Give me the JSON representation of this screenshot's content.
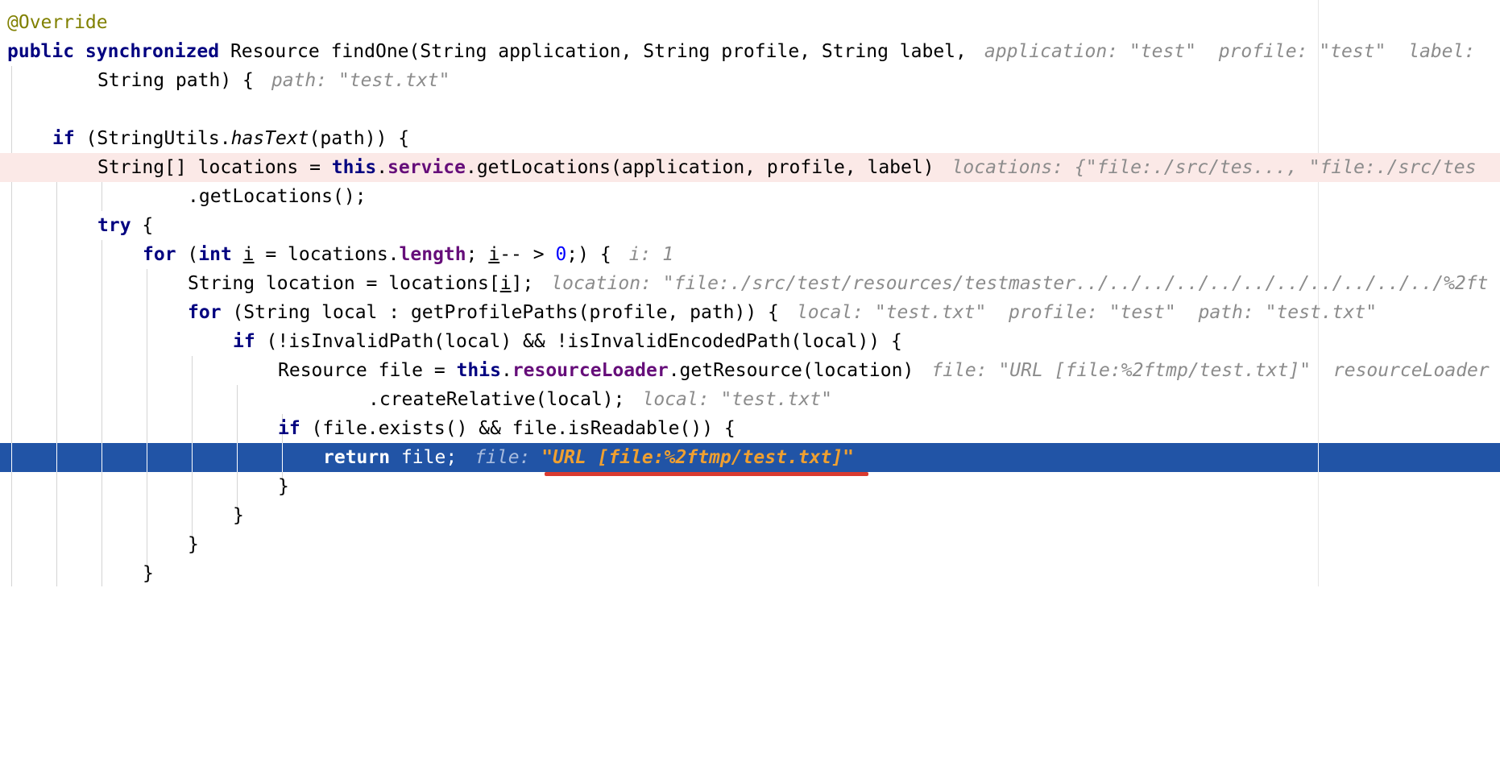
{
  "code": {
    "l1": "@Override",
    "l2_kw": "public synchronized",
    "l2_sig": " Resource findOne(String application, String profile, String label,",
    "l2_hint_k1": "application:",
    "l2_hint_v1": "\"test\"",
    "l2_hint_k2": "profile:",
    "l2_hint_v2": "\"test\"",
    "l2_hint_k3": "label:",
    "l3_code": "String path) {",
    "l3_hint_k": "path:",
    "l3_hint_v": "\"test.txt\"",
    "l5_kw": "if",
    "l5_a": " (StringUtils.",
    "l5_it": "hasText",
    "l5_b": "(path)) {",
    "l6_a": "String[] locations = ",
    "l6_this": "this",
    "l6_dot": ".",
    "l6_field": "service",
    "l6_b": ".getLocations(application, profile, label)",
    "l6_hint_k": "locations:",
    "l6_hint_v": "{\"file:./src/tes..., \"file:./src/tes",
    "l7_code": ".getLocations();",
    "l8_kw": "try",
    "l8_b": " {",
    "l9_kw": "for",
    "l9_a": " (",
    "l9_int": "int",
    "l9_sp": " ",
    "l9_i": "i",
    "l9_b": " = locations.",
    "l9_len": "length",
    "l9_c": "; ",
    "l9_i2": "i",
    "l9_d": "-- > ",
    "l9_zero": "0",
    "l9_e": ";) {",
    "l9_hint_k": "i:",
    "l9_hint_v": "1",
    "l10_a": "String location = locations[",
    "l10_i": "i",
    "l10_b": "];",
    "l10_hint_k": "location:",
    "l10_hint_v": "\"file:./src/test/resources/testmaster../../../../../../../../../../../%2ft",
    "l11_kw": "for",
    "l11_b": " (String local : getProfilePaths(profile, path)) {",
    "l11_hint_k1": "local:",
    "l11_hint_v1": "\"test.txt\"",
    "l11_hint_k2": "profile:",
    "l11_hint_v2": "\"test\"",
    "l11_hint_k3": "path:",
    "l11_hint_v3": "\"test.txt\"",
    "l12_kw": "if",
    "l12_b": " (!isInvalidPath(local) && !isInvalidEncodedPath(local)) {",
    "l13_a": "Resource file = ",
    "l13_this": "this",
    "l13_dot": ".",
    "l13_field": "resourceLoader",
    "l13_b": ".getResource(location)",
    "l13_hint_k1": "file:",
    "l13_hint_v1": "\"URL [file:%2ftmp/test.txt]\"",
    "l13_hint_k2": "resourceLoader",
    "l14_code": ".createRelative(local);",
    "l14_hint_k": "local:",
    "l14_hint_v": "\"test.txt\"",
    "l15_kw": "if",
    "l15_b": " (file.exists() && file.isReadable()) {",
    "l16_kw": "return",
    "l16_b": " file;",
    "l16_hint_k": "file:",
    "l16_hint_v": "\"URL [file:%2ftmp/test.txt]\"",
    "close": "}"
  },
  "colors": {
    "keyword": "#000080",
    "annotation": "#808000",
    "field": "#660e7a",
    "number": "#0000ff",
    "hint": "#8c8c8c",
    "execution_line": "#2154a6",
    "error_line": "#fbe9e7",
    "underline_mark": "#d93a2f"
  }
}
